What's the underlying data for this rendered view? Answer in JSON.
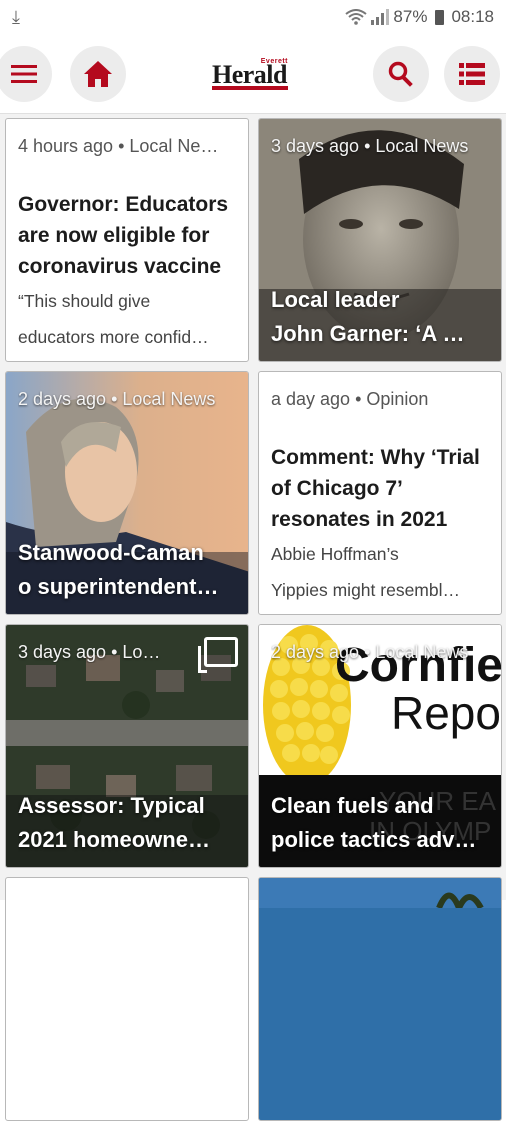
{
  "status_bar": {
    "download_icon": "download-icon",
    "battery": "87%",
    "time": "08:18"
  },
  "toolbar": {
    "menu_icon": "hamburger-menu-icon",
    "home_icon": "home-icon",
    "logo_text": "Herald",
    "logo_small_text": "Everett",
    "search_icon": "search-icon",
    "sections_icon": "list-icon",
    "accent_color": "#b40a1e"
  },
  "cards": [
    {
      "type": "text",
      "meta": "4 hours ago • Local Ne…",
      "title": "Governor: Educators are now eligible for coronavirus vaccine",
      "excerpt_line1": "“This should give",
      "excerpt_line2": "educators more confid…"
    },
    {
      "type": "photo",
      "meta": "3 days ago • Local News",
      "title_line1": "Local leader",
      "title_line2": "John Garner: ‘A …"
    },
    {
      "type": "photo",
      "meta": "2 days ago • Local News",
      "title_line1": "Stanwood-Caman",
      "title_line2": "o superintendent…"
    },
    {
      "type": "text",
      "meta": "a day ago • Opinion",
      "title": "Comment: Why ‘Trial of Chicago 7’ resonates in 2021",
      "excerpt_line1": "Abbie Hoffman’s",
      "excerpt_line2": "Yippies might resembl…"
    },
    {
      "type": "photo",
      "meta": "3 days ago • Lo…",
      "title_line1": "Assessor: Typical",
      "title_line2": "2021 homeowne…",
      "gallery_icon": "image-gallery-icon"
    },
    {
      "type": "photo",
      "meta": "2 days ago • Local News",
      "title_line1": "Clean fuels and",
      "title_line2": "police tactics adv…",
      "image_text_1": "Cornfie",
      "image_text_2": "Repo",
      "image_text_3": "YOUR EA",
      "image_text_4": "IN OLYMP"
    }
  ]
}
